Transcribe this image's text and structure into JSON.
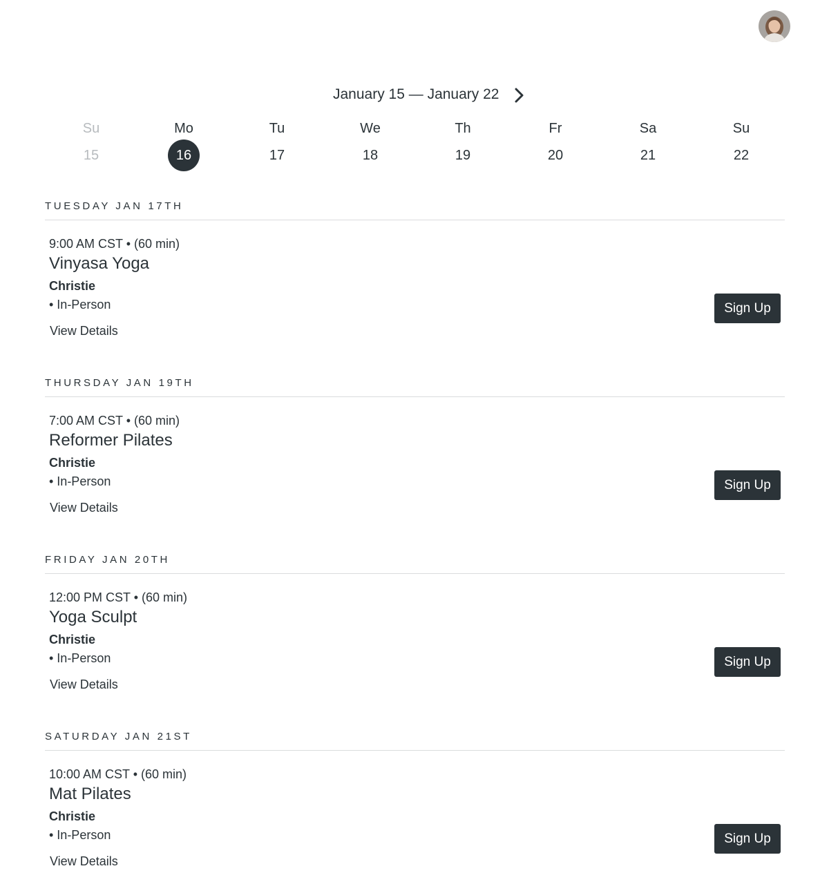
{
  "header": {
    "avatar_icon": "user-avatar-photo"
  },
  "week": {
    "range_label": "January 15 — January 22",
    "next_icon": "chevron-right-icon",
    "days": [
      {
        "abbr": "Su",
        "num": "15",
        "state": "past"
      },
      {
        "abbr": "Mo",
        "num": "16",
        "state": "selected"
      },
      {
        "abbr": "Tu",
        "num": "17",
        "state": "default"
      },
      {
        "abbr": "We",
        "num": "18",
        "state": "default"
      },
      {
        "abbr": "Th",
        "num": "19",
        "state": "default"
      },
      {
        "abbr": "Fr",
        "num": "20",
        "state": "default"
      },
      {
        "abbr": "Sa",
        "num": "21",
        "state": "default"
      },
      {
        "abbr": "Su",
        "num": "22",
        "state": "default"
      }
    ]
  },
  "sections": [
    {
      "heading": "TUESDAY JAN 17TH",
      "class": {
        "time": "9:00 AM CST • (60 min)",
        "title": "Vinyasa Yoga",
        "instructor": "Christie",
        "location": "• In-Person",
        "details_label": "View Details",
        "signup_label": "Sign Up"
      }
    },
    {
      "heading": "THURSDAY JAN 19TH",
      "class": {
        "time": "7:00 AM CST • (60 min)",
        "title": "Reformer Pilates",
        "instructor": "Christie",
        "location": "• In-Person",
        "details_label": "View Details",
        "signup_label": "Sign Up"
      }
    },
    {
      "heading": "FRIDAY JAN 20TH",
      "class": {
        "time": "12:00 PM CST • (60 min)",
        "title": "Yoga Sculpt",
        "instructor": "Christie",
        "location": "• In-Person",
        "details_label": "View Details",
        "signup_label": "Sign Up"
      }
    },
    {
      "heading": "SATURDAY JAN 21ST",
      "class": {
        "time": "10:00 AM CST • (60 min)",
        "title": "Mat Pilates",
        "instructor": "Christie",
        "location": "• In-Person",
        "details_label": "View Details",
        "signup_label": "Sign Up"
      }
    }
  ],
  "colors": {
    "primary_dark": "#2b3338",
    "muted_text": "#b7bbbe",
    "divider": "#dadcdd",
    "background": "#ffffff"
  }
}
